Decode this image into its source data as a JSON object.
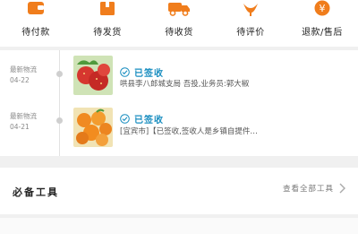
{
  "orders": [
    {
      "key": "pay",
      "label": "待付款",
      "icon": "wallet-icon"
    },
    {
      "key": "ship",
      "label": "待发货",
      "icon": "package-icon"
    },
    {
      "key": "receive",
      "label": "待收货",
      "icon": "truck-icon"
    },
    {
      "key": "review",
      "label": "待评价",
      "icon": "review-icon"
    },
    {
      "key": "refund",
      "label": "退款/售后",
      "icon": "refund-icon"
    }
  ],
  "logistics": [
    {
      "meta_label": "最新物流",
      "date": "04-22",
      "status": "已签收",
      "description": "哄县李八郎城支局 吾投,业务员:郭大椒",
      "thumb": "strawberry"
    },
    {
      "meta_label": "最新物流",
      "date": "04-21",
      "status": "已签收",
      "description": "[宜宾市]【已签收,签收人是乡镇自提件…",
      "thumb": "orange"
    }
  ],
  "tools": {
    "title": "必备工具",
    "view_all": "查看全部工具"
  },
  "colors": {
    "accent": "#f07d1c",
    "status_blue": "#1a8ec0"
  }
}
